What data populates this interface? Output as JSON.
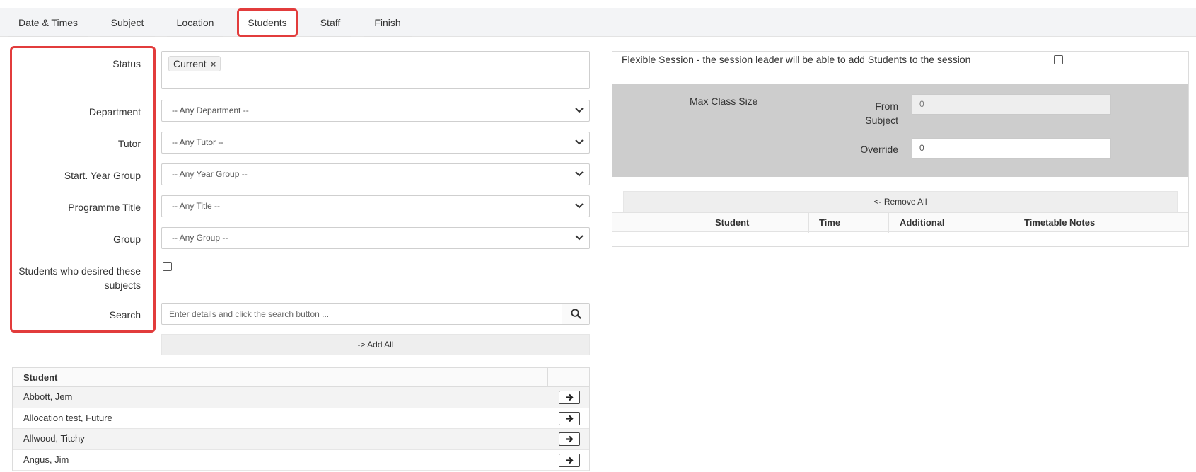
{
  "tabs": [
    {
      "label": "Date & Times"
    },
    {
      "label": "Subject"
    },
    {
      "label": "Location"
    },
    {
      "label": "Students",
      "active": true
    },
    {
      "label": "Staff"
    },
    {
      "label": "Finish"
    }
  ],
  "filters": {
    "status_label": "Status",
    "status_chip": "Current",
    "chip_remove": "×",
    "department_label": "Department",
    "department_value": "-- Any Department --",
    "tutor_label": "Tutor",
    "tutor_value": "-- Any Tutor --",
    "year_label": "Start. Year Group",
    "year_value": "-- Any Year Group --",
    "programme_label": "Programme Title",
    "programme_value": "-- Any Title --",
    "group_label": "Group",
    "group_value": "-- Any Group --",
    "desired_label_1": "Students who desired these",
    "desired_label_2": "subjects",
    "search_label": "Search",
    "search_placeholder": "Enter details and click the search button ..."
  },
  "add_all_label": "-> Add All",
  "student_table": {
    "header": "Student",
    "rows": [
      "Abbott, Jem",
      "Allocation test, Future",
      "Allwood, Titchy",
      "Angus, Jim"
    ]
  },
  "session": {
    "flexible_label": "Flexible Session - the session leader will be able to add Students to the session",
    "max_class_size_label": "Max Class Size",
    "from_label_1": "From",
    "from_label_2": "Subject",
    "from_value": "0",
    "override_label": "Override",
    "override_value": "0",
    "remove_all_label": "<- Remove All",
    "columns": [
      "Student",
      "Time",
      "Additional",
      "Timetable Notes"
    ]
  },
  "icons": {
    "search": "search-icon",
    "arrow": "arrow-right-icon",
    "chevron": "chevron-down-icon"
  },
  "colors": {
    "highlight": "#e23c3c"
  }
}
